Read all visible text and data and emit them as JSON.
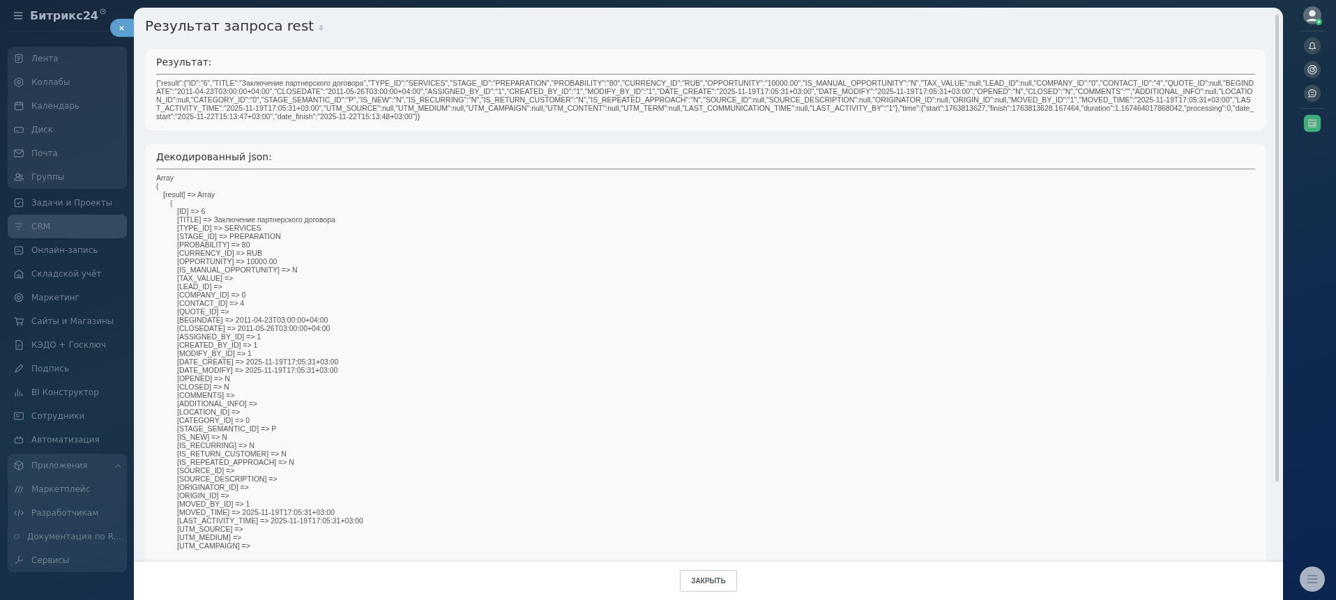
{
  "sidebar": {
    "title": "Битрикс24",
    "sections": [
      {
        "kind": "group",
        "items": [
          {
            "label": "Лента",
            "selected": false
          },
          {
            "label": "Коллабы",
            "selected": false
          },
          {
            "label": "Календарь",
            "selected": false
          },
          {
            "label": "Диск",
            "selected": false
          },
          {
            "label": "Почта",
            "selected": false
          },
          {
            "label": "Группы",
            "selected": false
          }
        ]
      },
      {
        "kind": "list",
        "items": [
          {
            "label": "Задачи и Проекты",
            "selected": false
          },
          {
            "label": "CRM",
            "selected": true
          },
          {
            "label": "Онлайн-запись",
            "selected": false
          },
          {
            "label": "Складской учёт",
            "selected": false
          },
          {
            "label": "Маркетинг",
            "selected": false
          },
          {
            "label": "Сайты и Магазины",
            "selected": false
          },
          {
            "label": "КЭДО + Госключ",
            "selected": false
          },
          {
            "label": "Подпись",
            "selected": false
          },
          {
            "label": "BI Конструктор",
            "selected": false
          },
          {
            "label": "Сотрудники",
            "selected": false
          },
          {
            "label": "Автоматизация",
            "selected": false
          }
        ]
      },
      {
        "kind": "group",
        "header": {
          "label": "Приложения",
          "expanded": true
        },
        "items": [
          {
            "label": "Маркетплейс",
            "selected": false
          },
          {
            "label": "Разработчикам",
            "selected": false
          },
          {
            "label": "Документация по R...",
            "selected": false
          },
          {
            "label": "Сервисы",
            "selected": false
          }
        ]
      }
    ]
  },
  "slider": {
    "title": "Результат запроса rest",
    "result": {
      "label": "Результат:",
      "text": "{\"result\":{\"ID\":\"6\",\"TITLE\":\"Заключение партнерского договора\",\"TYPE_ID\":\"SERVICES\",\"STAGE_ID\":\"PREPARATION\",\"PROBABILITY\":\"80\",\"CURRENCY_ID\":\"RUB\",\"OPPORTUNITY\":\"10000.00\",\"IS_MANUAL_OPPORTUNITY\":\"N\",\"TAX_VALUE\":null,\"LEAD_ID\":null,\"COMPANY_ID\":\"0\",\"CONTACT_ID\":\"4\",\"QUOTE_ID\":null,\"BEGINDATE\":\"2011-04-23T03:00:00+04:00\",\"CLOSEDATE\":\"2011-05-26T03:00:00+04:00\",\"ASSIGNED_BY_ID\":\"1\",\"CREATED_BY_ID\":\"1\",\"MODIFY_BY_ID\":\"1\",\"DATE_CREATE\":\"2025-11-19T17:05:31+03:00\",\"DATE_MODIFY\":\"2025-11-19T17:05:31+03:00\",\"OPENED\":\"N\",\"CLOSED\":\"N\",\"COMMENTS\":\"\",\"ADDITIONAL_INFO\":null,\"LOCATION_ID\":null,\"CATEGORY_ID\":\"0\",\"STAGE_SEMANTIC_ID\":\"P\",\"IS_NEW\":\"N\",\"IS_RECURRING\":\"N\",\"IS_RETURN_CUSTOMER\":\"N\",\"IS_REPEATED_APPROACH\":\"N\",\"SOURCE_ID\":null,\"SOURCE_DESCRIPTION\":null,\"ORIGINATOR_ID\":null,\"ORIGIN_ID\":null,\"MOVED_BY_ID\":\"1\",\"MOVED_TIME\":\"2025-11-19T17:05:31+03:00\",\"LAST_ACTIVITY_TIME\":\"2025-11-19T17:05:31+03:00\",\"UTM_SOURCE\":null,\"UTM_MEDIUM\":null,\"UTM_CAMPAIGN\":null,\"UTM_CONTENT\":null,\"UTM_TERM\":null,\"LAST_COMMUNICATION_TIME\":null,\"LAST_ACTIVITY_BY\":\"1\"},\"time\":{\"start\":1763813627,\"finish\":1763813628.167464,\"duration\":1.167464017868042,\"processing\":0,\"date_start\":\"2025-11-22T15:13:47+03:00\",\"date_finish\":\"2025-11-22T15:13:48+03:00\"}}"
    },
    "decoded": {
      "label": "Декодированный json:",
      "lines": [
        {
          "text": "Array"
        },
        {
          "text": "(",
          "children": [
            {
              "text": "[result] => Array",
              "children": [
                {
                  "text": "(",
                  "children": [
                    {
                      "text": "[ID] => 6"
                    },
                    {
                      "text": "[TITLE] => Заключение партнерского договора"
                    },
                    {
                      "text": "[TYPE_ID] => SERVICES"
                    },
                    {
                      "text": "[STAGE_ID] => PREPARATION"
                    },
                    {
                      "text": "[PROBABILITY] => 80"
                    },
                    {
                      "text": "[CURRENCY_ID] => RUB"
                    },
                    {
                      "text": "[OPPORTUNITY] => 10000.00"
                    },
                    {
                      "text": "[IS_MANUAL_OPPORTUNITY] => N"
                    },
                    {
                      "text": "[TAX_VALUE] =>"
                    },
                    {
                      "text": "[LEAD_ID] =>"
                    },
                    {
                      "text": "[COMPANY_ID] => 0"
                    },
                    {
                      "text": "[CONTACT_ID] => 4"
                    },
                    {
                      "text": "[QUOTE_ID] =>"
                    },
                    {
                      "text": "[BEGINDATE] => 2011-04-23T03:00:00+04:00"
                    },
                    {
                      "text": "[CLOSEDATE] => 2011-05-26T03:00:00+04:00"
                    },
                    {
                      "text": "[ASSIGNED_BY_ID] => 1"
                    },
                    {
                      "text": "[CREATED_BY_ID] => 1"
                    },
                    {
                      "text": "[MODIFY_BY_ID] => 1"
                    },
                    {
                      "text": "[DATE_CREATE] => 2025-11-19T17:05:31+03:00"
                    },
                    {
                      "text": "[DATE_MODIFY] => 2025-11-19T17:05:31+03:00"
                    },
                    {
                      "text": "[OPENED] => N"
                    },
                    {
                      "text": "[CLOSED] => N"
                    },
                    {
                      "text": "[COMMENTS] =>"
                    },
                    {
                      "text": "[ADDITIONAL_INFO] =>"
                    },
                    {
                      "text": "[LOCATION_ID] =>"
                    },
                    {
                      "text": "[CATEGORY_ID] => 0"
                    },
                    {
                      "text": "[STAGE_SEMANTIC_ID] => P"
                    },
                    {
                      "text": "[IS_NEW] => N"
                    },
                    {
                      "text": "[IS_RECURRING] => N"
                    },
                    {
                      "text": "[IS_RETURN_CUSTOMER] => N"
                    },
                    {
                      "text": "[IS_REPEATED_APPROACH] => N"
                    },
                    {
                      "text": "[SOURCE_ID] =>"
                    },
                    {
                      "text": "[SOURCE_DESCRIPTION] =>"
                    },
                    {
                      "text": "[ORIGINATOR_ID] =>"
                    },
                    {
                      "text": "[ORIGIN_ID] =>"
                    },
                    {
                      "text": "[MOVED_BY_ID] => 1"
                    },
                    {
                      "text": "[MOVED_TIME] => 2025-11-19T17:05:31+03:00"
                    },
                    {
                      "text": "[LAST_ACTIVITY_TIME] => 2025-11-19T17:05:31+03:00"
                    },
                    {
                      "text": "[UTM_SOURCE] =>"
                    },
                    {
                      "text": "[UTM_MEDIUM] =>"
                    },
                    {
                      "text": "[UTM_CAMPAIGN] =>"
                    }
                  ]
                }
              ]
            }
          ]
        }
      ]
    },
    "close_button": "ЗАКРЫТЬ"
  }
}
